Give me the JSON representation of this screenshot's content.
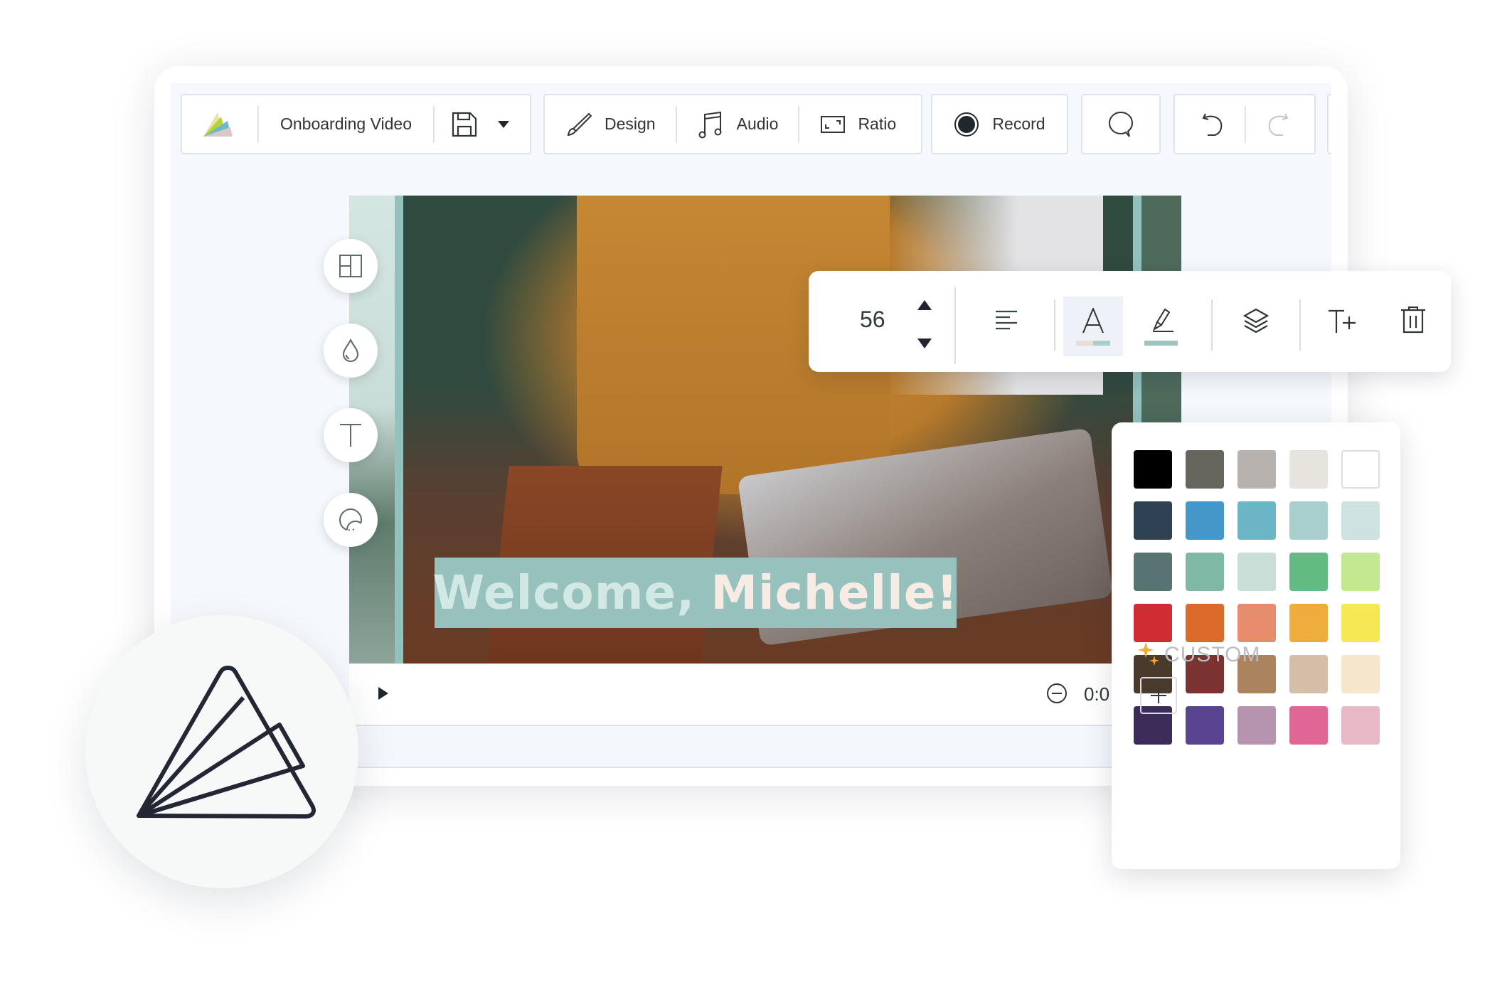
{
  "toolbar": {
    "project_title": "Onboarding Video",
    "design_label": "Design",
    "audio_label": "Audio",
    "ratio_label": "Ratio",
    "record_label": "Record"
  },
  "canvas": {
    "caption_part1": "Welcome,",
    "caption_part2": "Michelle!",
    "caption_bg": "#96c1bc",
    "caption_color1": "#d2e8e5",
    "caption_color2": "#f7ece4"
  },
  "playback": {
    "time_readout": "0:0"
  },
  "text_toolbar": {
    "font_size": "56",
    "text_color_underline": [
      "#e8ddd8",
      "#a9cfc9"
    ],
    "highlight_underline": "#9dc4bd"
  },
  "palette": {
    "swatches": [
      [
        "#000000",
        "#67665e",
        "#b7b2ae",
        "#e7e4df",
        "#ffffff"
      ],
      [
        "#2f4254",
        "#4597c9",
        "#6cb5c7",
        "#a8cfce",
        "#cde2e1"
      ],
      [
        "#577473",
        "#7fb8a4",
        "#c8ded6",
        "#62bb82",
        "#c4e88f"
      ],
      [
        "#cf2c33",
        "#dc6a2b",
        "#e78c6d",
        "#efae3b",
        "#f6e854"
      ],
      [
        "#4a3a2c",
        "#7a3331",
        "#ab835e",
        "#d4bea8",
        "#f6e6cb"
      ],
      [
        "#3d2b5a",
        "#584491",
        "#b693ae",
        "#e06696",
        "#e8b8c6"
      ]
    ],
    "custom_label": "CUSTOM",
    "custom_icon_color": "#f0ac36"
  }
}
